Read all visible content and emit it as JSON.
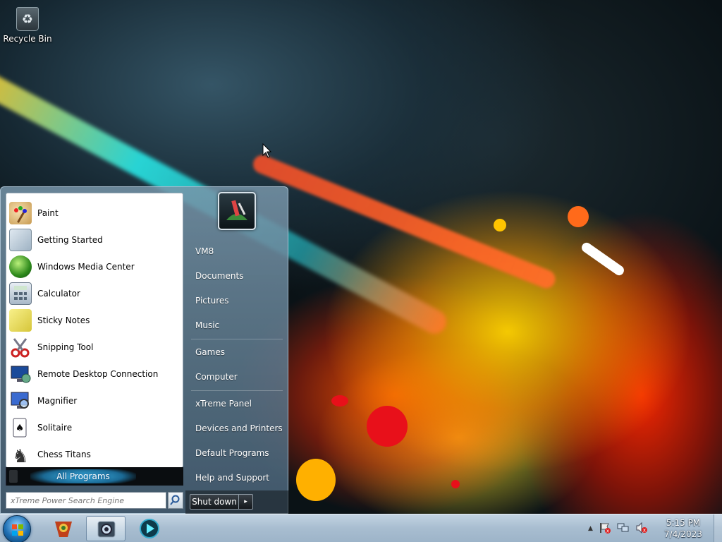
{
  "desktop": {
    "icons": [
      {
        "label": "Recycle Bin",
        "icon": "recycle-bin-icon"
      }
    ]
  },
  "start_menu": {
    "programs": [
      {
        "label": "Paint",
        "icon": "paint-icon"
      },
      {
        "label": "Getting Started",
        "icon": "getting-started-icon"
      },
      {
        "label": "Windows Media Center",
        "icon": "media-center-icon"
      },
      {
        "label": "Calculator",
        "icon": "calculator-icon"
      },
      {
        "label": "Sticky Notes",
        "icon": "sticky-notes-icon"
      },
      {
        "label": "Snipping Tool",
        "icon": "snipping-tool-icon"
      },
      {
        "label": "Remote Desktop Connection",
        "icon": "remote-desktop-icon"
      },
      {
        "label": "Magnifier",
        "icon": "magnifier-icon"
      },
      {
        "label": "Solitaire",
        "icon": "solitaire-icon"
      },
      {
        "label": "Chess Titans",
        "icon": "chess-icon"
      }
    ],
    "all_programs_label": "All Programs",
    "search_placeholder": "xTreme Power Search Engine",
    "right_items": [
      "VM8",
      "Documents",
      "Pictures",
      "Music",
      "Games",
      "Computer",
      "xTreme Panel",
      "Devices and Printers",
      "Default Programs",
      "Help and Support"
    ],
    "shutdown_label": "Shut down",
    "shutdown_arrow": "▸"
  },
  "taskbar": {
    "time": "5:15 PM",
    "date": "7/4/2023",
    "tray_chevron": "▲"
  }
}
